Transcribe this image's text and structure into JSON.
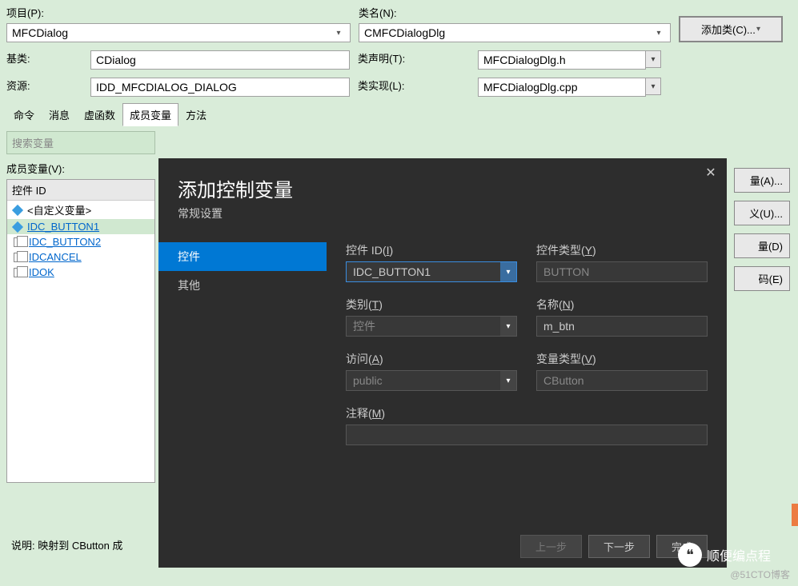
{
  "top": {
    "project_label": "项目(P):",
    "project_value": "MFCDialog",
    "classname_label": "类名(N):",
    "classname_value": "CMFCDialogDlg",
    "add_class_label": "添加类(C)...",
    "baseclass_label": "基类:",
    "baseclass_value": "CDialog",
    "declaration_label": "类声明(T):",
    "declaration_value": "MFCDialogDlg.h",
    "resource_label": "资源:",
    "resource_value": "IDD_MFCDIALOG_DIALOG",
    "implementation_label": "类实现(L):",
    "implementation_value": "MFCDialogDlg.cpp"
  },
  "tabs": {
    "items": [
      "命令",
      "消息",
      "虚函数",
      "成员变量",
      "方法"
    ],
    "active_index": 3
  },
  "search": {
    "placeholder": "搜索变量"
  },
  "tree": {
    "label": "成员变量(V):",
    "header": "控件 ID",
    "items": [
      {
        "text": "<自定义变量>",
        "icon": "diamond",
        "link": false
      },
      {
        "text": "IDC_BUTTON1",
        "icon": "diamond",
        "link": true,
        "selected": true
      },
      {
        "text": "IDC_BUTTON2",
        "icon": "square",
        "link": true
      },
      {
        "text": "IDCANCEL",
        "icon": "square",
        "link": true
      },
      {
        "text": "IDOK",
        "icon": "square",
        "link": true
      }
    ]
  },
  "right_buttons": [
    "量(A)...",
    "义(U)...",
    "量(D)",
    "码(E)"
  ],
  "description": "说明:  映射到 CButton 成",
  "dialog": {
    "title": "添加控制变量",
    "subtitle": "常规设置",
    "sidebar": {
      "items": [
        "控件",
        "其他"
      ],
      "active_index": 0
    },
    "fields": {
      "control_id_label": "控件 ID(I)",
      "control_id_value": "IDC_BUTTON1",
      "control_type_label": "控件类型(Y)",
      "control_type_value": "BUTTON",
      "category_label": "类别(T)",
      "category_value": "控件",
      "name_label": "名称(N)",
      "name_value": "m_btn",
      "access_label": "访问(A)",
      "access_value": "public",
      "vartype_label": "变量类型(V)",
      "vartype_value": "CButton",
      "comment_label": "注释(M)",
      "comment_value": ""
    },
    "buttons": {
      "prev": "上一步",
      "next": "下一步",
      "finish": "完成"
    }
  },
  "watermark": {
    "brand": "顺便编点程",
    "site": "@51CTO博客"
  }
}
